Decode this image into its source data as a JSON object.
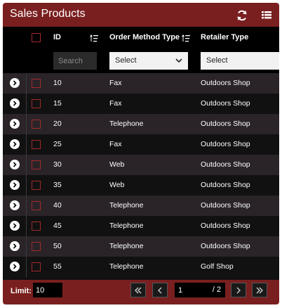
{
  "title": "Sales Products",
  "toolbar": {
    "refresh_icon": "refresh-icon",
    "menu_icon": "list-menu-icon"
  },
  "columns": {
    "id": "ID",
    "order_method": "Order Method Type",
    "retailer": "Retailer Type"
  },
  "filters": {
    "id_placeholder": "Search",
    "order_method_value": "Select",
    "retailer_value": "Select"
  },
  "rows": [
    {
      "id": "10",
      "order_method": "Fax",
      "retailer": "Outdoors Shop"
    },
    {
      "id": "15",
      "order_method": "Fax",
      "retailer": "Outdoors Shop"
    },
    {
      "id": "20",
      "order_method": "Telephone",
      "retailer": "Outdoors Shop"
    },
    {
      "id": "25",
      "order_method": "Fax",
      "retailer": "Outdoors Shop"
    },
    {
      "id": "30",
      "order_method": "Web",
      "retailer": "Outdoors Shop"
    },
    {
      "id": "35",
      "order_method": "Web",
      "retailer": "Outdoors Shop"
    },
    {
      "id": "40",
      "order_method": "Telephone",
      "retailer": "Outdoors Shop"
    },
    {
      "id": "45",
      "order_method": "Telephone",
      "retailer": "Outdoors Shop"
    },
    {
      "id": "50",
      "order_method": "Telephone",
      "retailer": "Outdoors Shop"
    },
    {
      "id": "55",
      "order_method": "Telephone",
      "retailer": "Golf Shop"
    }
  ],
  "footer": {
    "limit_label": "Limit:",
    "limit_value": "10",
    "page_value": "1",
    "page_total": "/ 2"
  },
  "colors": {
    "accent": "#7a1f1f",
    "checkbox_border": "#a02a2a"
  }
}
